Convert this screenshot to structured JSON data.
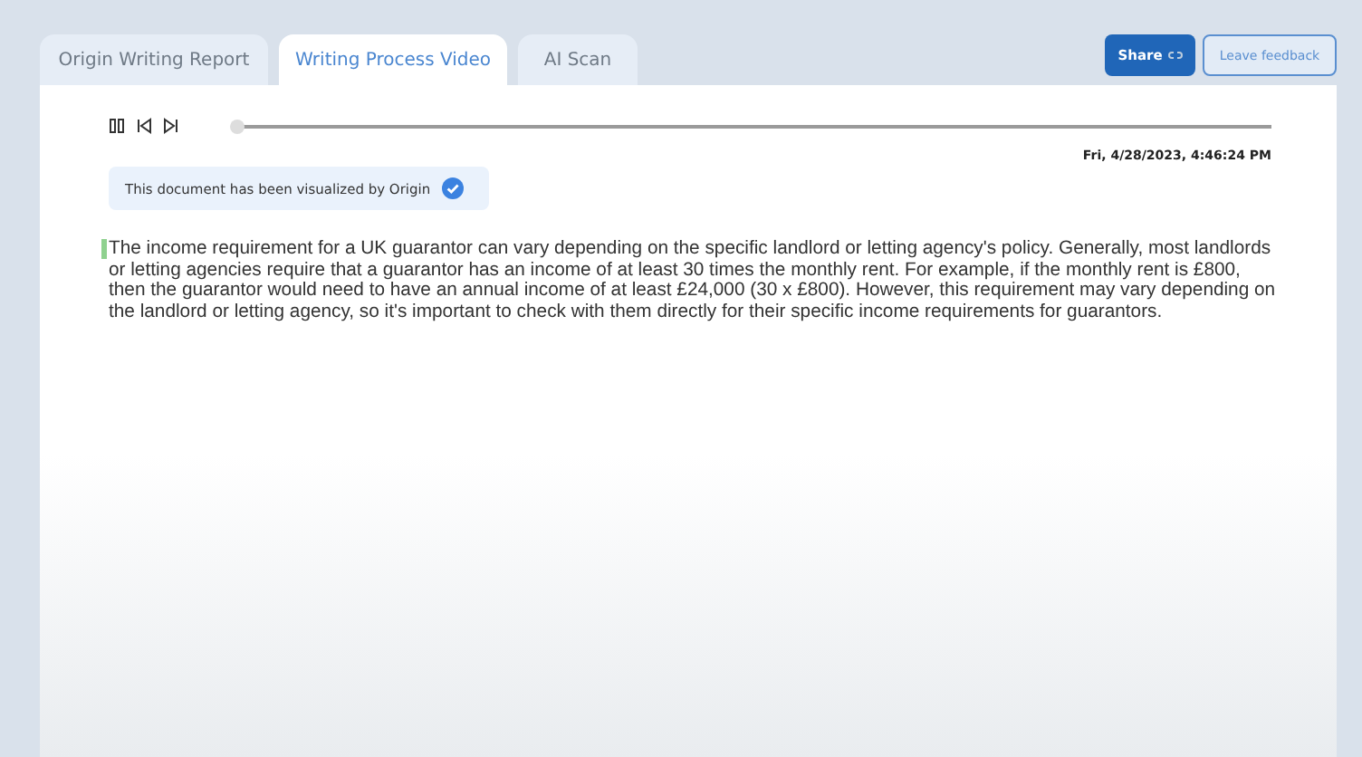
{
  "tabs": [
    {
      "label": "Origin Writing Report",
      "selected": false
    },
    {
      "label": "Writing Process Video",
      "selected": true
    },
    {
      "label": "AI Scan",
      "selected": false
    }
  ],
  "actions": {
    "share": "Share",
    "feedback": "Leave feedback"
  },
  "player": {
    "playing": true,
    "level": 0,
    "timestamp": "Fri, 4/28/2023, 4:46:24 PM"
  },
  "notice": {
    "text": "This document has been visualized by Origin",
    "verified": true
  },
  "document": {
    "text": "The income requirement for a UK guarantor can vary depending on the specific landlord or letting agency's policy. Generally, most landlords or letting agencies require that a guarantor has an income of at least 30 times the monthly rent. For example, if the monthly rent is £800, then the guarantor would need to have an annual income of at least £24,000 (30 x £800). However, this requirement may vary depending on the landlord or letting agency, so it's important to check with them directly for their specific income requirements for guarantors."
  }
}
